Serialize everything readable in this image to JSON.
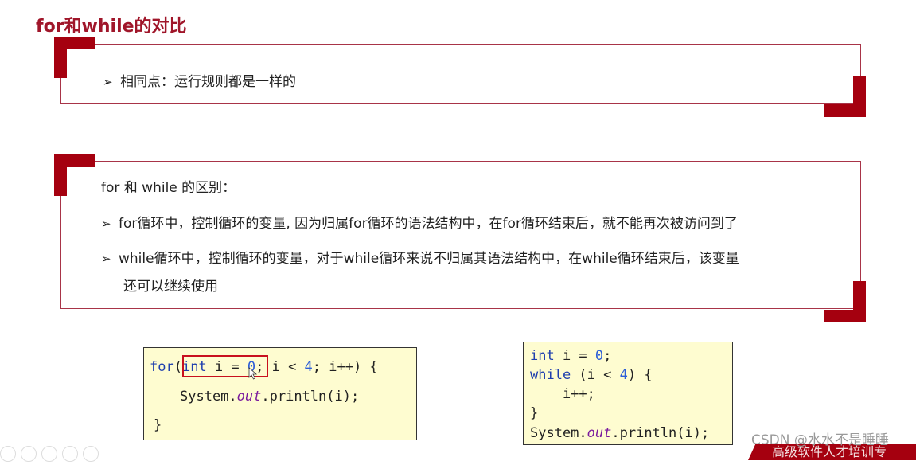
{
  "slide": {
    "title": "for和while的对比",
    "box1": {
      "bullet_icon": "arrow-bullet-icon",
      "text": "相同点：运行规则都是一样的"
    },
    "box2": {
      "heading": "for 和 while 的区别：",
      "bullets": [
        {
          "icon": "arrow-bullet-icon",
          "text": "for循环中，控制循环的变量, 因为归属for循环的语法结构中，在for循环结束后，就不能再次被访问到了"
        },
        {
          "icon": "arrow-bullet-icon",
          "text": "while循环中，控制循环的变量，对于while循环来说不归属其语法结构中，在while循环结束后，该变量",
          "continuation": "还可以继续使用"
        }
      ]
    },
    "code_for": {
      "lines": [
        "for(int i = 0; i < 4; i++) {",
        "    System.out.println(i);",
        "}"
      ],
      "highlight": "int i = 0"
    },
    "code_while": {
      "lines": [
        "int i = 0;",
        "while (i < 4) {",
        "    i++;",
        "}",
        "System.out.println(i);"
      ]
    },
    "watermark": "CSDN @水水不是睡睡",
    "banner_text": "高级软件人才培训专"
  },
  "colors": {
    "title": "#a0162a",
    "accent": "#a5000f",
    "box_border": "#a83448",
    "code_bg": "#fefcd0",
    "keyword": "#1f3fae",
    "field": "#7a1b9e"
  }
}
